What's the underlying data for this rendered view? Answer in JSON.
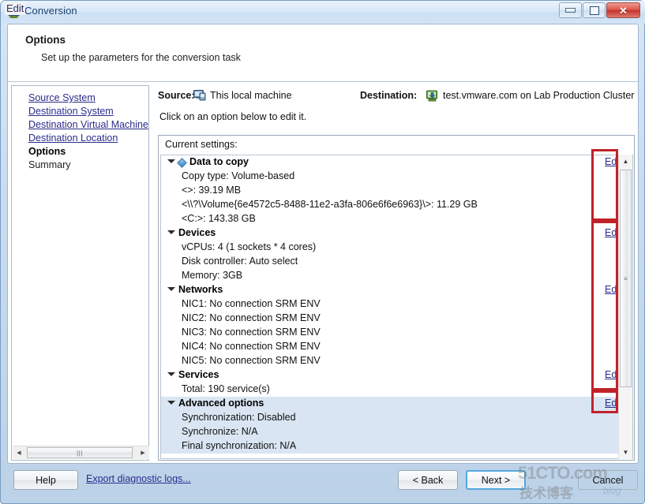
{
  "window": {
    "title": "Conversion",
    "overlay_artifact": "Edit",
    "icon": "converter-app-icon",
    "buttons": {
      "minimize": "minimize-icon",
      "maximize": "maximize-icon",
      "close": "✕"
    }
  },
  "header": {
    "title": "Options",
    "subtitle": "Set up the parameters for the conversion task"
  },
  "sidebar": {
    "items": [
      {
        "label": "Source System",
        "state": "link"
      },
      {
        "label": "Destination System",
        "state": "link"
      },
      {
        "label": "Destination Virtual Machine",
        "state": "link"
      },
      {
        "label": "Destination Location",
        "state": "link"
      },
      {
        "label": "Options",
        "state": "current"
      },
      {
        "label": "Summary",
        "state": "plain"
      }
    ]
  },
  "source_dest": {
    "source_label": "Source:",
    "source_icon": "computer-icon",
    "source_value": "This local machine",
    "destination_label": "Destination:",
    "destination_icon": "vcenter-server-icon",
    "destination_value": "test.vmware.com on Lab Production Cluster"
  },
  "hint": "Click on an option below to edit it.",
  "settings": {
    "caption": "Current settings:",
    "edit_label": "Edit",
    "groups": [
      {
        "title": "Data to copy",
        "icon": "blue-diamond-icon",
        "has_edit": true,
        "selected": false,
        "rows": [
          "Copy type: Volume-based",
          "<>: 39.19 MB",
          "<\\\\?\\Volume{6e4572c5-8488-11e2-a3fa-806e6f6e6963}\\>: 11.29 GB",
          "<C:>: 143.38 GB"
        ]
      },
      {
        "title": "Devices",
        "icon": null,
        "has_edit": true,
        "selected": false,
        "rows": [
          "vCPUs: 4 (1 sockets * 4 cores)",
          "Disk controller: Auto select",
          "Memory: 3GB"
        ]
      },
      {
        "title": "Networks",
        "icon": null,
        "has_edit": true,
        "selected": false,
        "rows": [
          "NIC1: No connection SRM ENV",
          "NIC2: No connection SRM ENV",
          "NIC3: No connection SRM ENV",
          "NIC4: No connection SRM ENV",
          "NIC5: No connection SRM ENV"
        ]
      },
      {
        "title": "Services",
        "icon": null,
        "has_edit": true,
        "selected": false,
        "rows": [
          "Total: 190 service(s)"
        ]
      },
      {
        "title": "Advanced options",
        "icon": null,
        "has_edit": true,
        "selected": true,
        "rows": [
          "Synchronization: Disabled",
          "Synchronize: N/A",
          "Final synchronization: N/A"
        ]
      }
    ]
  },
  "footer": {
    "help": "Help",
    "export_logs": "Export diagnostic logs...",
    "back": "< Back",
    "next": "Next >",
    "cancel": "Cancel"
  },
  "watermark": {
    "line1": "51CTO.com",
    "line2": "技术博客",
    "blog": "blog"
  },
  "colors": {
    "link": "#2b2b8c",
    "annotation_red": "#c1222a",
    "selected_row": "#d9e5f2",
    "title_text": "#1d3f70"
  }
}
